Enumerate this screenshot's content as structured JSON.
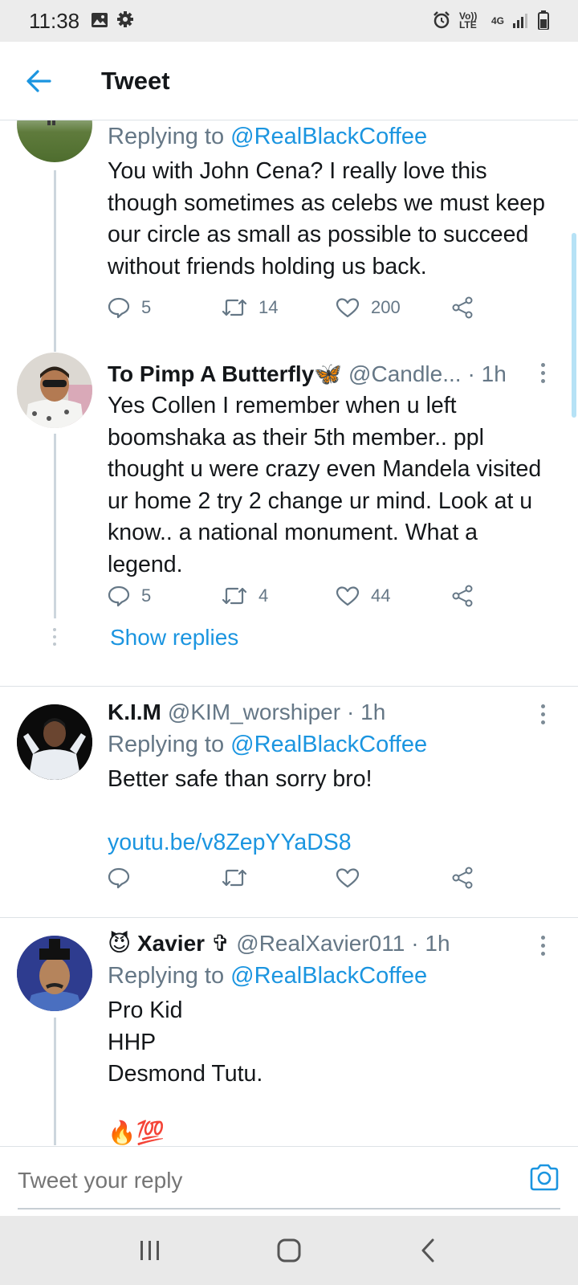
{
  "status_bar": {
    "time": "11:38",
    "volte": "Vo)) LTE",
    "network": "4G"
  },
  "header": {
    "title": "Tweet"
  },
  "tweets": [
    {
      "reply_prefix": "Replying to",
      "reply_to": "@RealBlackCoffee",
      "text": "You with John Cena? I really love this though sometimes as celebs we must keep our circle as small as possible to succeed without friends holding us back.",
      "stats": {
        "replies": "5",
        "retweets": "14",
        "likes": "200"
      }
    },
    {
      "name": "To Pimp A Butterfly🦋",
      "handle": "@Candle...",
      "time": "· 1h",
      "text": "Yes Collen I remember when u left boomshaka as their 5th member.. ppl thought u were crazy even Mandela visited ur home 2 try 2 change ur mind. Look at u know.. a national monument. What a legend.",
      "stats": {
        "replies": "5",
        "retweets": "4",
        "likes": "44"
      },
      "show_replies": "Show replies"
    },
    {
      "name": "K.I.M",
      "handle": "@KIM_worshiper",
      "time": "· 1h",
      "reply_prefix": "Replying to",
      "reply_to": "@RealBlackCoffee",
      "text": "Better safe than sorry bro!",
      "link": "youtu.be/v8ZepYYaDS8"
    },
    {
      "name": "😈 Xavier ✞",
      "handle": "@RealXavier011",
      "time": "· 1h",
      "reply_prefix": "Replying to",
      "reply_to": "@RealBlackCoffee",
      "text": "Pro Kid\nHHP\nDesmond Tutu.",
      "partial": "🔥💯"
    }
  ],
  "reply_bar": {
    "placeholder": "Tweet your reply"
  },
  "colors": {
    "accent": "#1b95e0",
    "muted": "#657786",
    "text": "#14171a",
    "divider": "#dde2e6"
  },
  "icons": [
    "gallery-icon",
    "gear-icon",
    "alarm-icon",
    "signal-icon",
    "battery-icon",
    "back-arrow-icon",
    "reply-icon",
    "retweet-icon",
    "like-icon",
    "share-icon",
    "more-icon",
    "camera-icon",
    "recents-icon",
    "home-icon",
    "back-icon"
  ]
}
